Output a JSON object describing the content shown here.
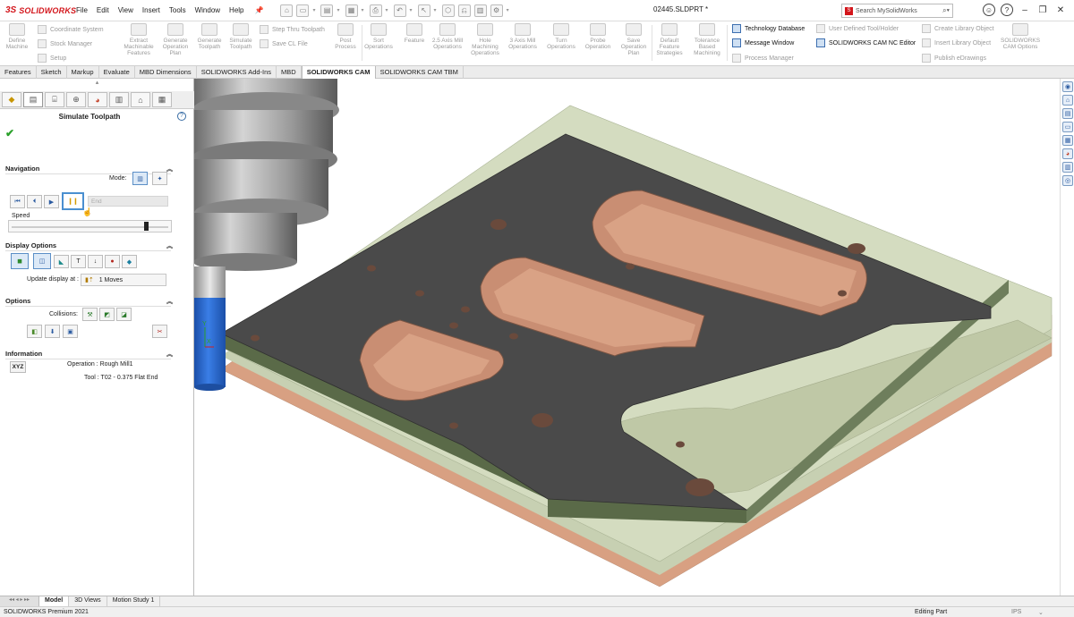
{
  "app": {
    "logo_ds": "3S",
    "logo_name": "SOLIDWORKS",
    "menus": [
      "File",
      "Edit",
      "View",
      "Insert",
      "Tools",
      "Window",
      "Help"
    ],
    "document_title": "02445.SLDPRT *",
    "search_placeholder": "Search MySolidWorks"
  },
  "ribbon": {
    "buttons": [
      {
        "label": "Define Machine",
        "enabled": false
      },
      {
        "label": "Extract Machinable Features",
        "enabled": false
      },
      {
        "label": "Generate Operation Plan",
        "enabled": false
      },
      {
        "label": "Generate Toolpath",
        "enabled": false
      },
      {
        "label": "Simulate Toolpath",
        "enabled": false
      },
      {
        "label": "Post Process",
        "enabled": false
      },
      {
        "label": "Sort Operations",
        "enabled": false
      },
      {
        "label": "Feature",
        "enabled": false
      },
      {
        "label": "2.5 Axis Mill Operations",
        "enabled": false
      },
      {
        "label": "Hole Machining Operations",
        "enabled": false
      },
      {
        "label": "3 Axis Mill Operations",
        "enabled": false
      },
      {
        "label": "Turn Operations",
        "enabled": false
      },
      {
        "label": "Probe Operation",
        "enabled": false
      },
      {
        "label": "Save Operation Plan",
        "enabled": false
      },
      {
        "label": "Default Feature Strategies",
        "enabled": false
      },
      {
        "label": "Tolerance Based Machining",
        "enabled": false
      },
      {
        "label": "SOLIDWORKS CAM Options",
        "enabled": false
      }
    ],
    "small_left": [
      "Coordinate System",
      "Stock Manager",
      "Setup"
    ],
    "small_mid": [
      "Step Thru Toolpath",
      "Save CL File"
    ],
    "small_db": [
      "Technology Database",
      "Message Window",
      "Process Manager"
    ],
    "nc_editor": "SOLIDWORKS CAM NC Editor",
    "small_right1": [
      "User Defined Tool/Holder",
      "Insert Library Object"
    ],
    "small_right2": [
      "Create Library Object",
      "Publish eDrawings"
    ]
  },
  "command_tabs": {
    "items": [
      "Features",
      "Sketch",
      "Markup",
      "Evaluate",
      "MBD Dimensions",
      "SOLIDWORKS Add-Ins",
      "MBD",
      "SOLIDWORKS CAM",
      "SOLIDWORKS CAM TBM"
    ],
    "active": "SOLIDWORKS CAM"
  },
  "panel": {
    "title": "Simulate Toolpath",
    "navigation": {
      "header": "Navigation",
      "mode_label": "Mode:",
      "end_placeholder": "End",
      "speed_label": "Speed",
      "speed_value": 0.87
    },
    "display": {
      "header": "Display Options",
      "update_label": "Update display at :",
      "moves_value": "1 Moves"
    },
    "options": {
      "header": "Options",
      "collisions_label": "Collisions:"
    },
    "information": {
      "header": "Information",
      "xyz_label": "XYZ",
      "operation": "Operation : Rough Mill1",
      "tool": "Tool : T02 - 0.375 Flat End"
    }
  },
  "bottom_tabs": {
    "items": [
      "Model",
      "3D Views",
      "Motion Study 1"
    ],
    "active": "Model"
  },
  "status": {
    "product": "SOLIDWORKS Premium 2021",
    "mode": "Editing Part",
    "units": "IPS"
  },
  "colors": {
    "brand": "#d3151b",
    "plate_top": "#4a4a4a",
    "stock": "#c6d0b4",
    "copper": "#d9a284",
    "tool": "#2c6bd1"
  }
}
